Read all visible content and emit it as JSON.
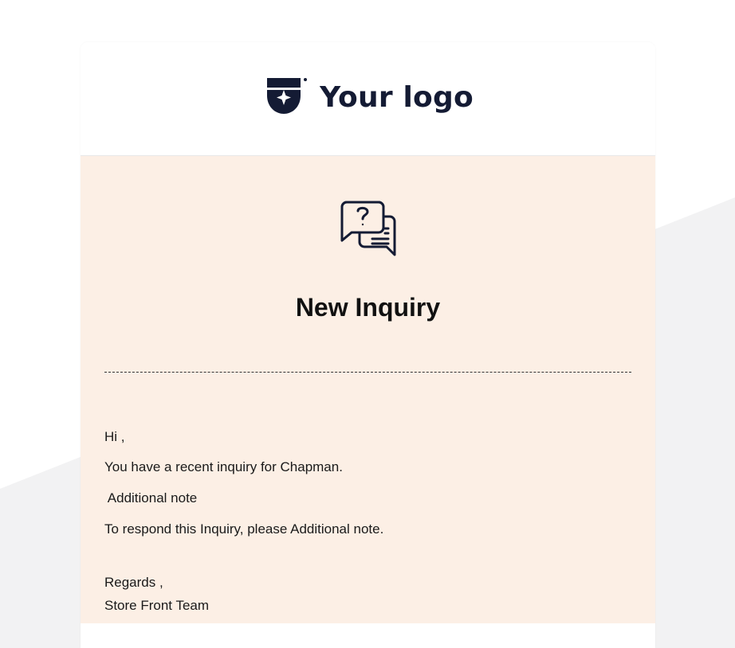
{
  "logo": {
    "text": "Your logo",
    "icon": "shield-star-icon"
  },
  "email": {
    "icon": "question-chat-icon",
    "title": "New Inquiry",
    "greeting": "Hi ,",
    "message": "You have a recent inquiry for Chapman.",
    "note": " Additional note",
    "respond": "To respond this Inquiry, please Additional note.",
    "regards": "Regards ,",
    "signature": "Store Front Team"
  },
  "colors": {
    "body_bg": "#fcefe5",
    "logo": "#141b34",
    "page_shape": "#f2f2f3"
  }
}
